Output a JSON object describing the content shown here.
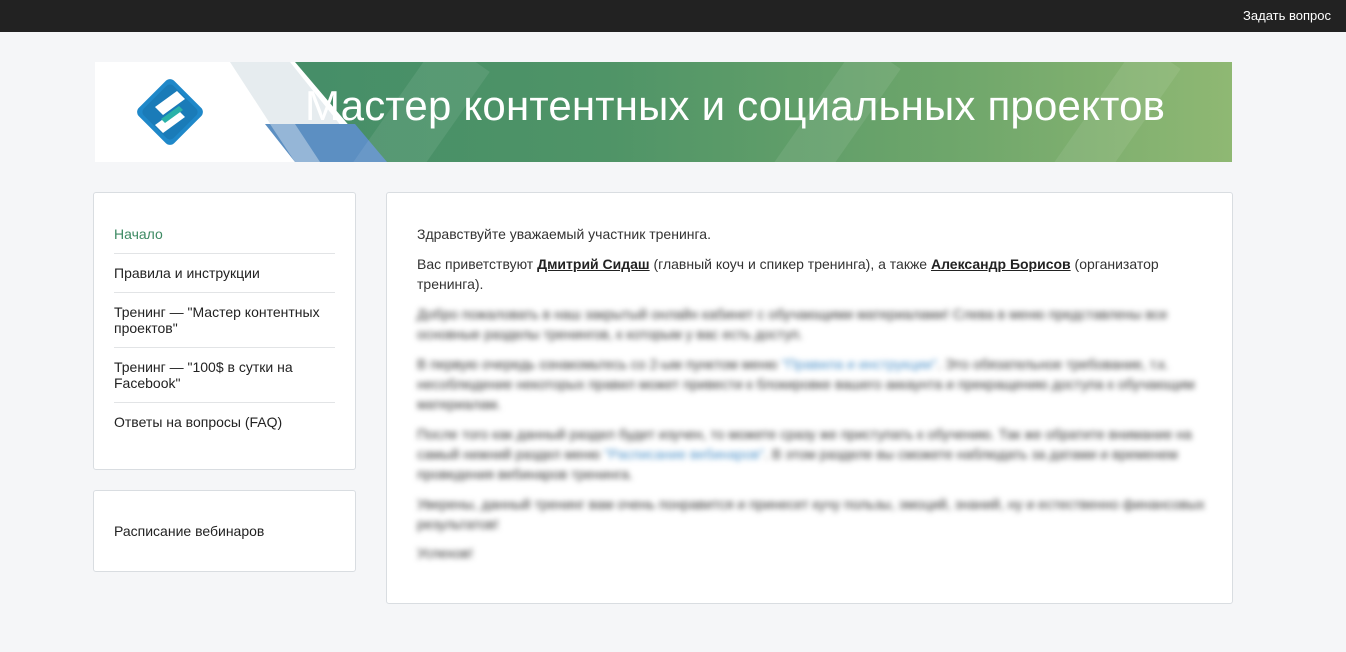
{
  "topbar": {
    "ask_label": "Задать вопрос"
  },
  "banner": {
    "title": "Мастер контентных и социальных проектов",
    "accent": "#3f8a68",
    "logo_icon": "s-logo-icon"
  },
  "nav": {
    "items": [
      {
        "label": "Начало",
        "active": true
      },
      {
        "label": "Правила и инструкции"
      },
      {
        "label": "Тренинг — \"Мастер контентных проектов\""
      },
      {
        "label": "Тренинг — \"100$ в сутки на Facebook\""
      },
      {
        "label": "Ответы на вопросы (FAQ)"
      }
    ]
  },
  "schedule": {
    "label": "Расписание вебинаров"
  },
  "content": {
    "greeting": "Здравствуйте уважаемый участник тренинга.",
    "intro_prefix": "Вас приветствуют ",
    "coach_name": "Дмитрий Сидаш",
    "intro_middle": " (главный коуч и спикер тренинга), а также ",
    "organizer_name": "Александр Борисов",
    "intro_suffix": " (организатор тренинга).",
    "blurred": {
      "p1": "Добро пожаловать в наш закрытый онлайн кабинет с обучающими материалами! Слева в меню представлены все основные разделы тренингов, к которым у вас есть доступ.",
      "p2_before": "В первую очередь ознакомьтесь со 2-ым пунктом меню ",
      "p2_link": "\"Правила и инструкции\"",
      "p2_after": ". Это обязательное требование, т.к. несоблюдение некоторых правил может привести к блокировке вашего аккаунта и прекращению доступа к обучающим материалам.",
      "p3_before": "После того как данный раздел будет изучен, то можете сразу же приступать к обучению. Так же обратите внимание на самый нижний раздел меню ",
      "p3_link": "\"Расписание вебинаров\"",
      "p3_after": ". В этом разделе вы сможете наблюдать за датами и временем проведения вебинаров тренинга.",
      "p4": "Уверены, данный тренинг вам очень понравится и принесет кучу пользы, эмоций, знаний, ну и естественно финансовых результатов!",
      "p5": "Успехов!"
    }
  }
}
